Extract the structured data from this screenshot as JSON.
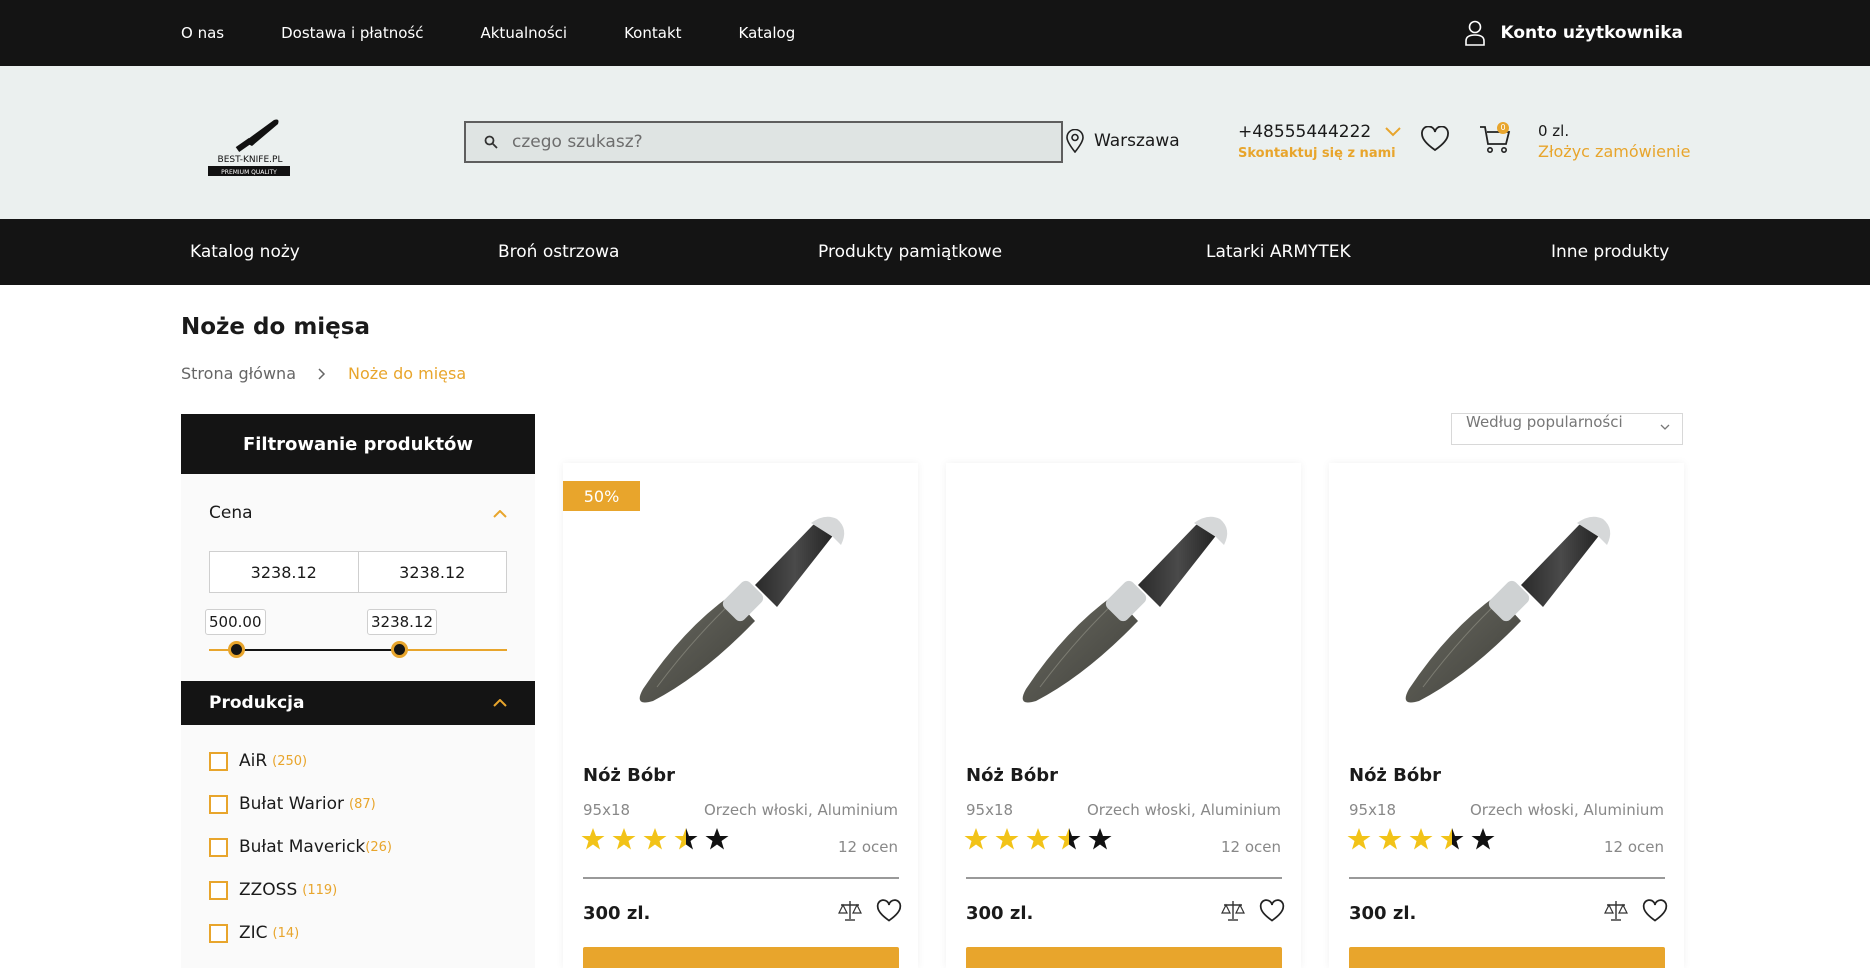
{
  "topnav": {
    "items": [
      "O nas",
      "Dostawa i płatność",
      "Aktualności",
      "Kontakt",
      "Katalog"
    ],
    "account": "Konto użytkownika"
  },
  "header": {
    "logo_text": "BEST-KNIFE.PL",
    "logo_sub": "PREMIUM QUALITY",
    "search_placeholder": "czego szukasz?",
    "city": "Warszawa",
    "phone": "+48555444222",
    "contact_link": "Skontaktuj się z nami",
    "cart_count": "0",
    "cart_total": "0 zl.",
    "order_link": "Złożyc zamówienie"
  },
  "catnav": [
    "Katalog noży",
    "Broń ostrzowa",
    "Produkty pamiątkowe",
    "Latarki ARMYTEK",
    "Inne produkty"
  ],
  "page": {
    "title": "Noże do mięsa",
    "breadcrumb": [
      "Strona główna",
      "Noże do mięsa"
    ]
  },
  "filters": {
    "heading": "Filtrowanie produktów",
    "price_label": "Cena",
    "price_from": "3238.12",
    "price_to": "3238.12",
    "slider_min": "500.00",
    "slider_max": "3238.12",
    "production_label": "Produkcja",
    "brands": [
      {
        "name": "AiR",
        "count": "(250)"
      },
      {
        "name": "Bułat Warior",
        "count": "(87)"
      },
      {
        "name": "Bułat Maverick",
        "count": "(26)"
      },
      {
        "name": "ZZOSS",
        "count": "(119)"
      },
      {
        "name": "ZIC",
        "count": "(14)"
      }
    ]
  },
  "sort": {
    "value": "Według popularności"
  },
  "products": [
    {
      "badge": "50%",
      "name": "Nóż Bóbr",
      "size": "95x18",
      "material": "Orzech włoski, Aluminium",
      "rating": 3.5,
      "reviews": "12 ocen",
      "price": "300 zl."
    },
    {
      "badge": "",
      "name": "Nóż Bóbr",
      "size": "95x18",
      "material": "Orzech włoski, Aluminium",
      "rating": 3.5,
      "reviews": "12 ocen",
      "price": "300 zl."
    },
    {
      "badge": "",
      "name": "Nóż Bóbr",
      "size": "95x18",
      "material": "Orzech włoski, Aluminium",
      "rating": 3.5,
      "reviews": "12 ocen",
      "price": "300 zl."
    }
  ],
  "colors": {
    "accent": "#e8a52c",
    "dark": "#141414",
    "header_bg": "#ebf0ef"
  }
}
